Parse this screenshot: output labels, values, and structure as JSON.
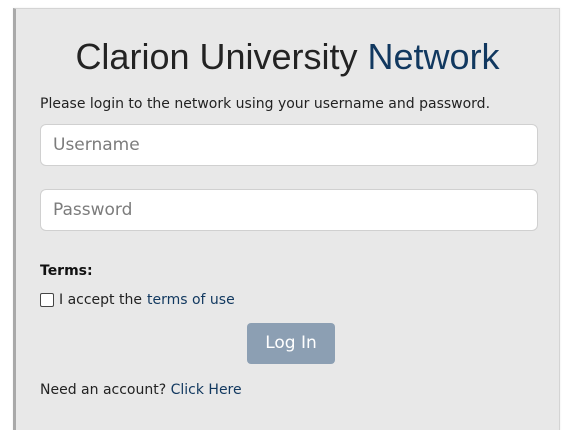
{
  "login": {
    "title_main": "Clarion University",
    "title_accent": "Network",
    "intro": "Please login to the network using your username and password.",
    "username_placeholder": "Username",
    "password_placeholder": "Password",
    "terms_label": "Terms:",
    "accept_prefix": "I accept the",
    "terms_link": "terms of use",
    "login_button": "Log In",
    "account_prefix": "Need an account?",
    "account_link": "Click Here"
  },
  "colors": {
    "accent": "#11385f",
    "button": "#8c9fb3",
    "panel": "#e8e8e8"
  }
}
